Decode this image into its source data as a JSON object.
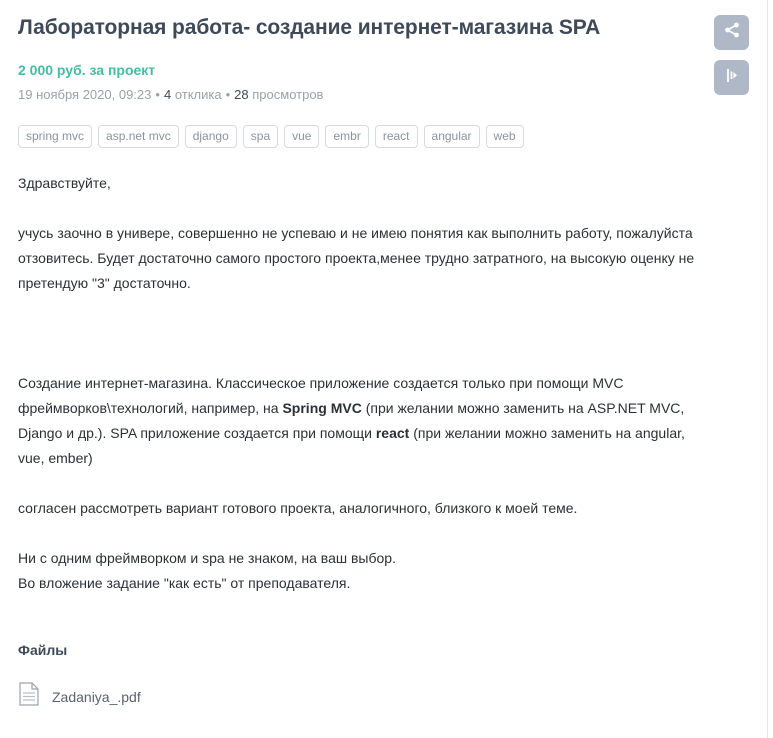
{
  "title": "Лабораторная работа- создание интернет-магазина SPA",
  "price": "2 000 руб. за проект",
  "meta": {
    "date": "19 ноября 2020, 09:23",
    "separator": "•",
    "responses_count": "4",
    "responses_label": "отклика",
    "views_count": "28",
    "views_label": "просмотров"
  },
  "tags": [
    "spring mvc",
    "asp.net mvc",
    "django",
    "spa",
    "vue",
    "embr",
    "react",
    "angular",
    "web"
  ],
  "description": {
    "greeting": "Здравствуйте,",
    "para1": "учусь заочно в универе, совершенно не успеваю и не имею понятия как выполнить работу, пожалуйста отзовитесь. Будет достаточно самого простого проекта,менее трудно затратного, на высокую оценку не претендую \"3\" достаточно.",
    "para2_a": "Создание интернет-магазина. Классическое приложение создается только при помощи MVC фреймворков\\технологий, например, на ",
    "para2_b": "Spring MVC",
    "para2_c": " (при желании можно заменить на ASP.NET MVC, Django и др.). SPA приложение создается при помощи ",
    "para2_d": "react",
    "para2_e": " (при желании можно заменить на angular, vue, ember)",
    "para3": "согласен рассмотреть вариант готового проекта, аналогичного, близкого к моей теме.",
    "para4_line1": "Ни с одним фреймворком и spa не знаком, на ваш выбор.",
    "para4_line2": "Во вложение задание \"как есть\" от преподавателя."
  },
  "files": {
    "heading": "Файлы",
    "items": [
      {
        "name": "Zadaniya_.pdf",
        "icon": "document-icon"
      }
    ]
  },
  "side_actions": [
    {
      "icon": "share-icon"
    },
    {
      "icon": "report-icon"
    }
  ],
  "colors": {
    "accent": "#3fbfa4",
    "title": "#3f4a59",
    "side_button": "#aeb8c6",
    "meta": "#9aa1aa"
  }
}
